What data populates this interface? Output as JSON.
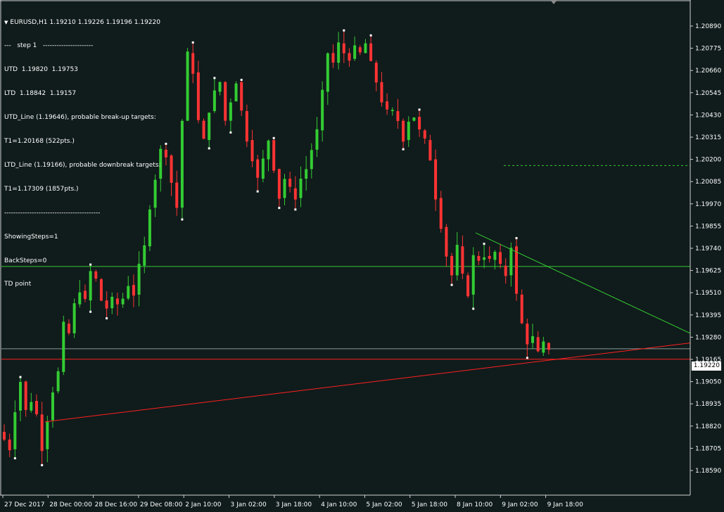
{
  "header": {
    "symbol_label": "EURUSD,H1",
    "ohlc": "1.19210 1.19226 1.19196 1.19220"
  },
  "info_lines": [
    "---   step 1   ----------------------",
    "UTD  1.19820  1.19753",
    "LTD  1.18842  1.19157",
    "UTD_Line (1.19646), probable break-up targets:",
    "T1=1.20168 (522pts.)",
    "LTD_Line (1.19166), probable downbreak targets:",
    "T1=1.17309 (1857pts.)",
    "------------------------------------------",
    "ShowingSteps=1",
    "BackSteps=0",
    "TD point"
  ],
  "price_axis": {
    "labels": [
      "1.20890",
      "1.20775",
      "1.20660",
      "1.20545",
      "1.20430",
      "1.20315",
      "1.20200",
      "1.20085",
      "1.19970",
      "1.19855",
      "1.19740",
      "1.19625",
      "1.19510",
      "1.19395",
      "1.19280",
      "1.19165",
      "1.19050",
      "1.18935",
      "1.18820",
      "1.18705",
      "1.18590"
    ],
    "min": 1.1859,
    "max": 1.2089
  },
  "time_axis": {
    "labels": [
      "27 Dec 2017",
      "28 Dec 00:00",
      "28 Dec 16:00",
      "29 Dec 08:00",
      "2 Jan 10:00",
      "3 Jan 02:00",
      "3 Jan 18:00",
      "4 Jan 10:00",
      "5 Jan 02:00",
      "5 Jan 18:00",
      "8 Jan 10:00",
      "9 Jan 02:00",
      "9 Jan 18:00"
    ]
  },
  "current_price": "1.19220",
  "lines": {
    "utd_level": 1.19646,
    "ltd_level": 1.19166,
    "target_level": 1.20168,
    "bid_level": 1.1922,
    "colors": {
      "bullish": "#33cc33",
      "bearish": "#ff3333",
      "utd": "#33cc33",
      "ltd": "#ff2020",
      "bid": "#8a9a9a",
      "target": "#33cc33",
      "td_point": "#ffffff"
    }
  },
  "trendlines": {
    "utd": {
      "from_price": 1.1982,
      "to_price": 1.193
    },
    "ltd": {
      "from_price": 1.18842,
      "to_price": 1.1925
    }
  },
  "chart_data": {
    "type": "candlestick",
    "path": [
      1.1875,
      1.187,
      1.189,
      1.1905,
      1.189,
      1.1895,
      1.1888,
      1.187,
      1.1885,
      1.19,
      1.191,
      1.1935,
      1.193,
      1.1945,
      1.1952,
      1.1947,
      1.1962,
      1.1958,
      1.1947,
      1.1943,
      1.1948,
      1.1945,
      1.1948,
      1.1955,
      1.195,
      1.1965,
      1.1975,
      1.1995,
      1.201,
      1.2025,
      1.2022,
      1.2008,
      1.1995,
      1.204,
      1.2075,
      1.2065,
      1.204,
      1.203,
      1.2045,
      1.2055,
      1.206,
      1.204,
      1.205,
      1.206,
      1.2045,
      1.203,
      1.202,
      1.201,
      1.202,
      1.203,
      1.2015,
      1.2,
      1.201,
      1.2005,
      1.2,
      1.201,
      1.2015,
      1.2025,
      1.2035,
      1.2055,
      1.2075,
      1.207,
      1.208,
      1.2075,
      1.2072,
      1.2078,
      1.2075,
      1.208,
      1.207,
      1.206,
      1.205,
      1.2045,
      1.2045,
      1.204,
      1.203,
      1.204,
      1.2042,
      1.2035,
      1.203,
      1.202,
      1.2,
      1.1985,
      1.197,
      1.196,
      1.1975,
      1.196,
      1.195,
      1.197,
      1.1968,
      1.197,
      1.1968,
      1.1972,
      1.1965,
      1.196,
      1.1975,
      1.195,
      1.1935,
      1.1925,
      1.1928,
      1.192,
      1.1925,
      1.1922
    ]
  }
}
